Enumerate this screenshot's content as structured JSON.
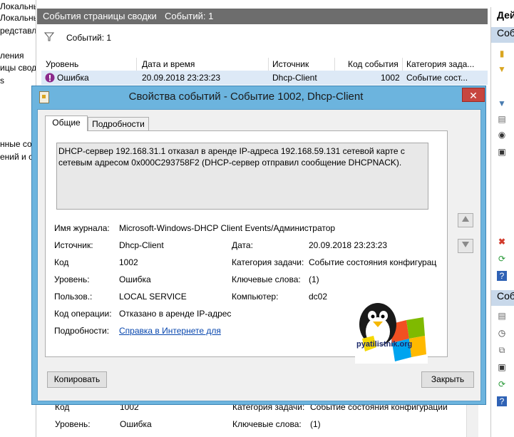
{
  "left_pane": {
    "lines": [
      "Локальнь",
      "редставль",
      "",
      "ления",
      "ицы свод",
      "s",
      "",
      "",
      "нные соб",
      "ений и с"
    ]
  },
  "center": {
    "title": "События страницы сводки",
    "count": "Событий: 1",
    "filter_count": "Событий: 1",
    "columns": [
      "Уровень",
      "Дата и время",
      "Источник",
      "Код события",
      "Категория зада..."
    ],
    "row": {
      "level": "Ошибка",
      "datetime": "20.09.2018 23:23:23",
      "source": "Dhcp-Client",
      "code": "1002",
      "category": "Событие сост..."
    }
  },
  "right_pane": {
    "header1": "Дей",
    "header2": "Собь",
    "header3": "Собь"
  },
  "bottom_details": {
    "code_label": "Код",
    "code_value": "1002",
    "category_label": "Категория задачи:",
    "category_value": "Событие состояния конфигурации",
    "level_label": "Уровень:",
    "level_value": "Ошибка",
    "keywords_label": "Ключевые слова:",
    "keywords_value": "(1)"
  },
  "dialog": {
    "title": "Свойства событий - Событие 1002, Dhcp-Client",
    "close": "✕",
    "tabs": [
      "Общие",
      "Подробности"
    ],
    "description": "DHCP-сервер 192.168.31.1 отказал в аренде IP-адреса 192.168.59.131 сетевой карте с сетевым адресом 0x000C293758F2 (DHCP-сервер отправил сообщение DHCPNACK).",
    "fields": {
      "log_name_label": "Имя журнала:",
      "log_name_value": "Microsoft-Windows-DHCP Client Events/Администратор",
      "source_label": "Источник:",
      "source_value": "Dhcp-Client",
      "date_label": "Дата:",
      "date_value": "20.09.2018 23:23:23",
      "code_label": "Код",
      "code_value": "1002",
      "category_label": "Категория задачи:",
      "category_value": "Событие состояния конфигурац",
      "level_label": "Уровень:",
      "level_value": "Ошибка",
      "keywords_label": "Ключевые слова:",
      "keywords_value": "(1)",
      "user_label": "Пользов.:",
      "user_value": "LOCAL SERVICE",
      "computer_label": "Компьютер:",
      "computer_value": "dc02",
      "opcode_label": "Код операции:",
      "opcode_value": "Отказано в аренде IP-адрес",
      "more_label": "Подробности:",
      "more_link": "Справка в Интернете для"
    },
    "watermark": "pyatilistnik.org",
    "copy_button": "Копировать",
    "close_button": "Закрыть"
  },
  "colors": {
    "dialog_frame": "#6cb4de",
    "close_red": "#c7463f",
    "selected_row": "#dde9f6",
    "header_gray": "#6d6d6d"
  }
}
